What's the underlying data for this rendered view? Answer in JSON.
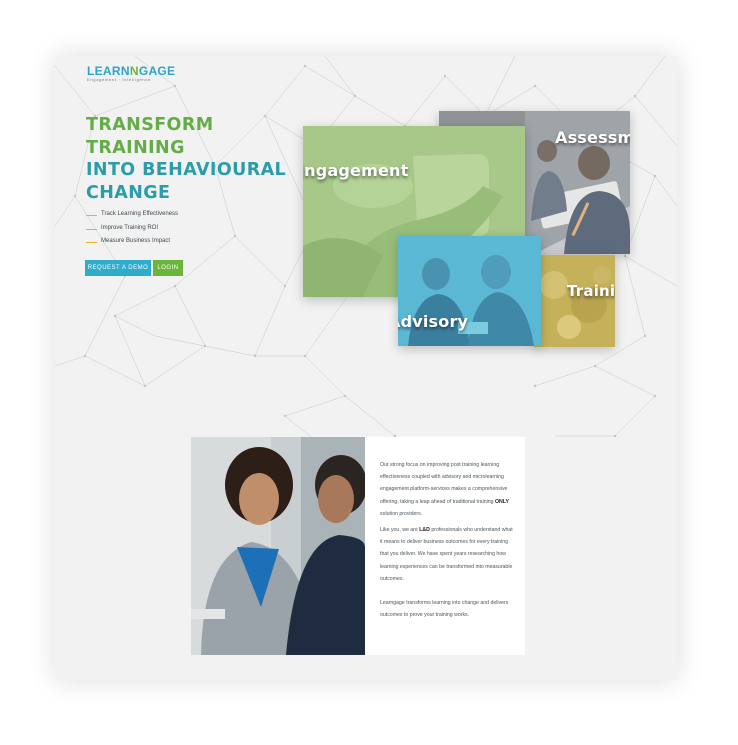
{
  "brand": {
    "logo_prefix": "LEARN",
    "logo_middle": "N",
    "logo_suffix": "GAGE",
    "tagline": "Engagement · Intelligence"
  },
  "hero": {
    "title_lines": [
      "TRANSFORM",
      "TRAINING",
      "INTO BEHAVIOURAL",
      "CHANGE"
    ],
    "features": [
      "Track Learning Effectiveness",
      "Improve Training ROI",
      "Measure Business Impact"
    ],
    "demo_button": "REQUEST A DEMO",
    "login_button": "LOGIN"
  },
  "services": {
    "engagement": "Engagement",
    "assessment": "Assessment",
    "advisory": "Advisory",
    "training": "Training"
  },
  "about": {
    "p1_a": "Our strong focus on improving post training learning effectiveness coupled with advisory and microlearning engagement platform-services makes a comprehensive offering, taking a leap ahead of traditional training ",
    "p1_bold": "ONLY",
    "p1_b": " solution providers.",
    "p2_a": "Like you, we are ",
    "p2_bold": "L&D",
    "p2_b": " professionals who understand what it means to deliver business outcomes for every training that you deliver. We have spent years researching how learning experiences can be transformed into measurable outcomes.",
    "p3": "Learngage transforms learning into change and delivers outcomes to prove your training works."
  },
  "colors": {
    "brand_green": "#64ad46",
    "brand_teal": "#2a9dab",
    "button_blue": "#2eaccc",
    "button_green": "#6cb53b",
    "feature_dash": "#e7b12c",
    "page_bg": "#f1f2f1"
  }
}
